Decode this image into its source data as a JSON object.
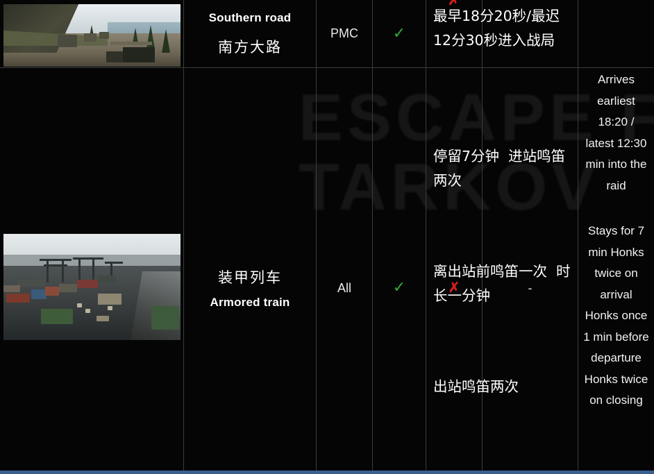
{
  "table": {
    "columns": [
      {
        "key": "image",
        "name": "location-image"
      },
      {
        "key": "name",
        "name": "location-name"
      },
      {
        "key": "faction",
        "name": "faction"
      },
      {
        "key": "available",
        "name": "available-check"
      },
      {
        "key": "requires_key",
        "name": "requires-key-check"
      },
      {
        "key": "extra",
        "name": "extra-column"
      },
      {
        "key": "notes_zh",
        "name": "notes-chinese"
      },
      {
        "key": "notes_en",
        "name": "notes-english"
      }
    ],
    "rows": [
      {
        "id": "southern-road",
        "name_en": "Southern road",
        "name_zh": "南方大路",
        "faction": "PMC",
        "mark_available": "✓",
        "notes_zh": "最早18分20秒/最迟12分30秒进入战局",
        "image_alt": "southern-road-screenshot"
      },
      {
        "id": "armored-train",
        "name_en": "Armored train",
        "name_zh": "装甲列车",
        "faction": "All",
        "mark_available": "✓",
        "mark_key": "✗",
        "extra": "-",
        "notes_zh_paragraphs": [
          "停留7分钟  进站鸣笛两次",
          "离出站前鸣笛一次  时长一分钟",
          "出站鸣笛两次"
        ],
        "notes_en": "Arrives earliest 18:20 / latest 12:30 min into the raid",
        "notes_en_2": "Stays for 7 min Honks twice on arrival Honks once 1 min before departure Honks twice on closing",
        "image_alt": "armored-train-yard-screenshot"
      }
    ],
    "partial_top_mark": "✗"
  },
  "watermark_text": "ESCAPE FROM\nTARKOV",
  "colors": {
    "background": "#050505",
    "gridline": "#3c3c3c",
    "check_green": "#2faa35",
    "cross_red": "#d01f1f",
    "text": "#ffffff",
    "bottom_strip": "#3a5f91"
  }
}
